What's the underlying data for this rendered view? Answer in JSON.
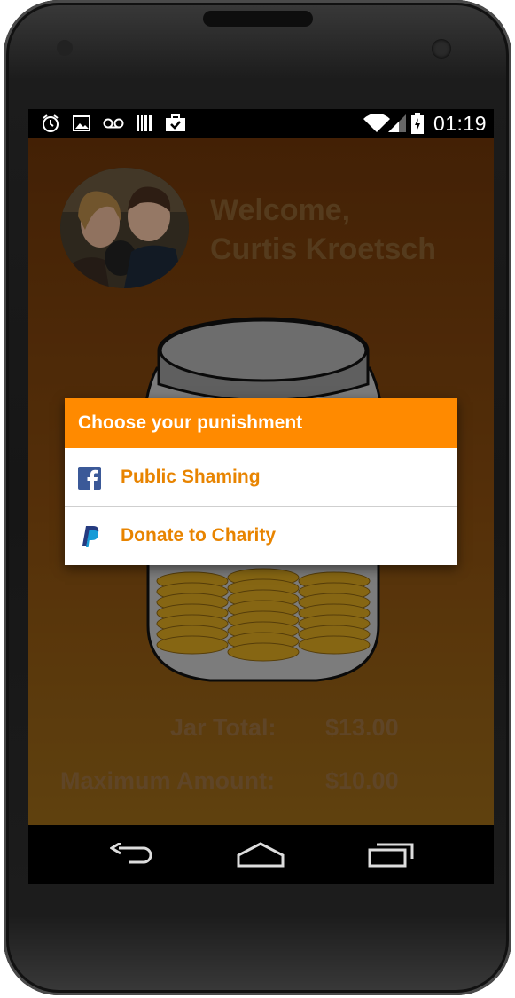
{
  "status_bar": {
    "time": "01:19",
    "left_icons": [
      "alarm-icon",
      "image-icon",
      "voicemail-icon",
      "barcode-icon",
      "briefcase-check-icon"
    ],
    "right_icons": [
      "wifi-icon",
      "cell-signal-icon",
      "battery-charging-icon"
    ]
  },
  "header": {
    "welcome_line1": "Welcome,",
    "welcome_line2": "Curtis Kroetsch"
  },
  "totals": {
    "jar_total_label": "Jar Total:",
    "jar_total_value": "$13.00",
    "max_amount_label": "Maximum Amount:",
    "max_amount_value": "$10.00"
  },
  "dialog": {
    "title": "Choose your punishment",
    "options": [
      {
        "label": "Public Shaming",
        "icon": "facebook-icon"
      },
      {
        "label": "Donate to Charity",
        "icon": "paypal-icon"
      }
    ]
  },
  "nav_bar": {
    "icons": [
      "back-icon",
      "home-icon",
      "recents-icon"
    ]
  },
  "colors": {
    "accent": "#ff8a00",
    "option_text": "#e88400",
    "facebook": "#3b5998",
    "paypal_dark": "#253b80",
    "paypal_light": "#179bd7"
  }
}
